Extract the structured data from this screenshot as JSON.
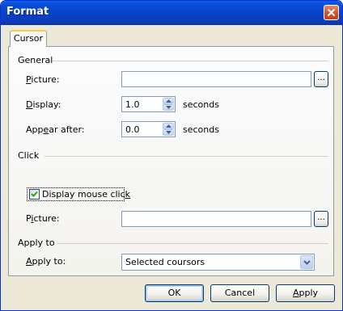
{
  "window": {
    "title": "Format"
  },
  "tabs": [
    {
      "label": "Cursor"
    }
  ],
  "general": {
    "heading": "General",
    "picture": {
      "label_pre": "",
      "label_ul": "P",
      "label_post": "icture:",
      "value": "",
      "browse": "..."
    },
    "display": {
      "label_pre": "",
      "label_ul": "D",
      "label_post": "isplay:",
      "value": "1.0",
      "unit": "seconds"
    },
    "appear_after": {
      "label_pre": "App",
      "label_ul": "e",
      "label_post": "ar after:",
      "value": "0.0",
      "unit": "seconds"
    }
  },
  "click": {
    "heading": "Click",
    "display_mouse_click": {
      "label_pre": "Display mouse clic",
      "label_ul": "k",
      "label_post": "",
      "checked": true
    },
    "picture": {
      "label_pre": "P",
      "label_ul": "i",
      "label_post": "cture:",
      "value": "",
      "browse": "..."
    }
  },
  "apply_to": {
    "heading": "Apply to",
    "label_pre": "",
    "label_ul": "A",
    "label_post": "pply to:",
    "selected": "Selected coursors"
  },
  "buttons": {
    "ok": "OK",
    "cancel": "Cancel",
    "apply_pre": "",
    "apply_ul": "A",
    "apply_post": "pply"
  },
  "colors": {
    "titlebar": "#0a4fd6",
    "dialog_bg": "#ece9d8",
    "tab_accent": "#ffc73c"
  }
}
